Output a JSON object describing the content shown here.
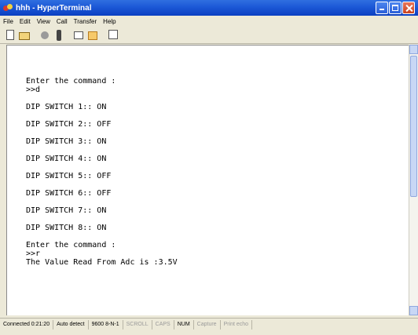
{
  "window": {
    "title": "hhh - HyperTerminal"
  },
  "menu": [
    "File",
    "Edit",
    "View",
    "Call",
    "Transfer",
    "Help"
  ],
  "toolbar": {
    "icons": [
      "new-icon",
      "open-icon",
      "call-icon",
      "disconnect-icon",
      "send-icon",
      "receive-icon",
      "properties-icon"
    ]
  },
  "terminal": {
    "lines": [
      "Enter the command :",
      ">>d",
      "",
      "DIP SWITCH 1:: ON",
      "",
      "DIP SWITCH 2:: OFF",
      "",
      "DIP SWITCH 3:: ON",
      "",
      "DIP SWITCH 4:: ON",
      "",
      "DIP SWITCH 5:: OFF",
      "",
      "DIP SWITCH 6:: OFF",
      "",
      "DIP SWITCH 7:: ON",
      "",
      "DIP SWITCH 8:: ON",
      "",
      "Enter the command :",
      ">>r",
      "The Value Read From Adc is :3.5V"
    ]
  },
  "status": {
    "connected": "Connected 0:21:20",
    "detect": "Auto detect",
    "baud": "9600 8-N-1",
    "scroll": "SCROLL",
    "caps": "CAPS",
    "num": "NUM",
    "capture": "Capture",
    "echo": "Print echo"
  }
}
